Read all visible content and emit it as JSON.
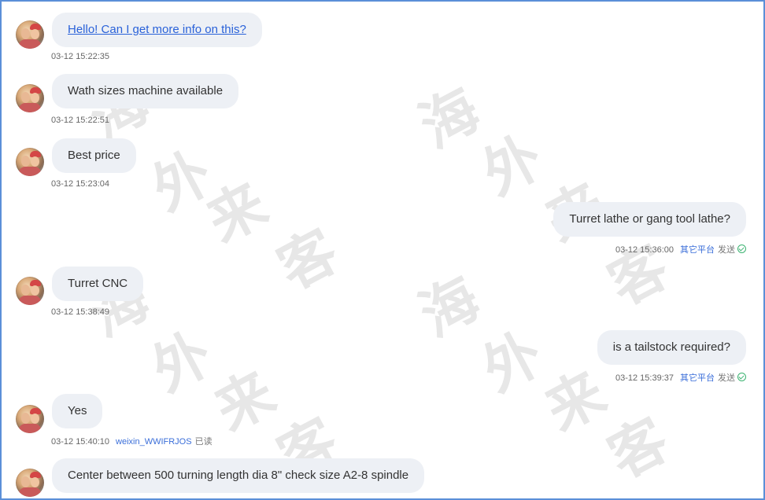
{
  "watermark": [
    "海",
    "外",
    "来",
    "客"
  ],
  "messages": [
    {
      "side": "left",
      "text": "Hello! Can I get more info on this?",
      "link": true,
      "time": "03-12 15:22:35"
    },
    {
      "side": "left",
      "text": "Wath sizes machine available",
      "time": "03-12 15:22:51"
    },
    {
      "side": "left",
      "text": "Best price",
      "time": "03-12 15:23:04"
    },
    {
      "side": "right",
      "text": "Turret lathe or gang tool lathe?",
      "time": "03-12 15:36:00",
      "platform": "其它平台",
      "status": "发送"
    },
    {
      "side": "left",
      "text": "Turret CNC",
      "time": "03-12 15:38:49"
    },
    {
      "side": "right",
      "text": "is a tailstock required?",
      "time": "03-12 15:39:37",
      "platform": "其它平台",
      "status": "发送"
    },
    {
      "side": "left",
      "text": "Yes",
      "time": "03-12 15:40:10",
      "reader": "weixin_WWIFRJOS",
      "read": "已读"
    },
    {
      "side": "left",
      "text": "Center between 500 turning length dia 8\" check size A2-8 spindle",
      "time": ""
    }
  ],
  "colors": {
    "border": "#5b8fd8",
    "bubble": "#edf0f5",
    "link": "#2a62d9",
    "accent": "#3a6ed9",
    "check": "#3cb371"
  }
}
